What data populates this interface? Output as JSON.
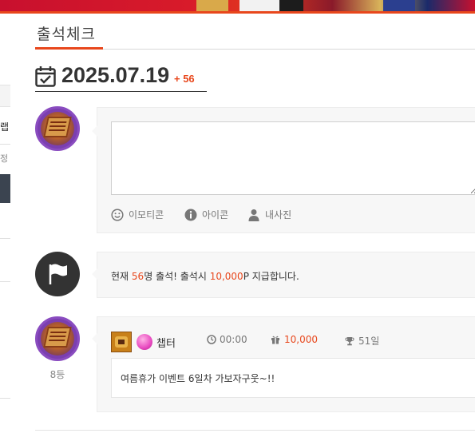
{
  "page": {
    "title": "출석체크",
    "date": "2025.07.19",
    "date_increment": "+ 56"
  },
  "sidebar_fragments": {
    "item1": "랩",
    "item2": "정"
  },
  "comment_form": {
    "placeholder": "",
    "tools": [
      {
        "label": "이모티콘",
        "icon": "smile-icon"
      },
      {
        "label": "아이콘",
        "icon": "info-icon"
      },
      {
        "label": "내사진",
        "icon": "person-icon"
      }
    ]
  },
  "notice": {
    "prefix": "현재 ",
    "count": "56",
    "middle": "명 출석! 출석시 ",
    "amount": "10,000",
    "suffix": "P 지급합니다."
  },
  "entry": {
    "nickname": "챕터",
    "time": "00:00",
    "points": "10,000",
    "days": "51일",
    "rank": "8등",
    "message": "여름휴가 이벤트 6일차 가보자구웃~!!"
  },
  "colors": {
    "accent": "#e8471c",
    "dark": "#333333",
    "avatar_purple": "#7b3fb0"
  }
}
